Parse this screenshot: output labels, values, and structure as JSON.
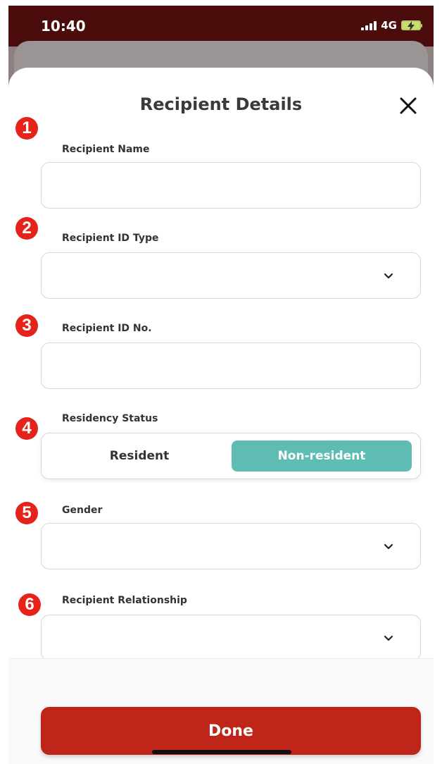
{
  "status_bar": {
    "time": "10:40",
    "network": "4G"
  },
  "sheet": {
    "title": "Recipient Details"
  },
  "fields": {
    "recipient_name": {
      "badge": "1",
      "label": "Recipient Name"
    },
    "recipient_id_type": {
      "badge": "2",
      "label": "Recipient ID Type"
    },
    "recipient_id_no": {
      "badge": "3",
      "label": "Recipient ID No."
    },
    "residency_status": {
      "badge": "4",
      "label": "Residency Status",
      "options": [
        "Resident",
        "Non-resident"
      ],
      "selected": "Non-resident"
    },
    "gender": {
      "badge": "5",
      "label": "Gender"
    },
    "recipient_relationship": {
      "badge": "6",
      "label": "Recipient Relationship"
    }
  },
  "footer": {
    "done_label": "Done"
  },
  "colors": {
    "accent_teal": "#5fbcb3",
    "primary_red": "#bf2519",
    "badge_red": "#e5231b",
    "status_bar": "#4a0d0c"
  }
}
